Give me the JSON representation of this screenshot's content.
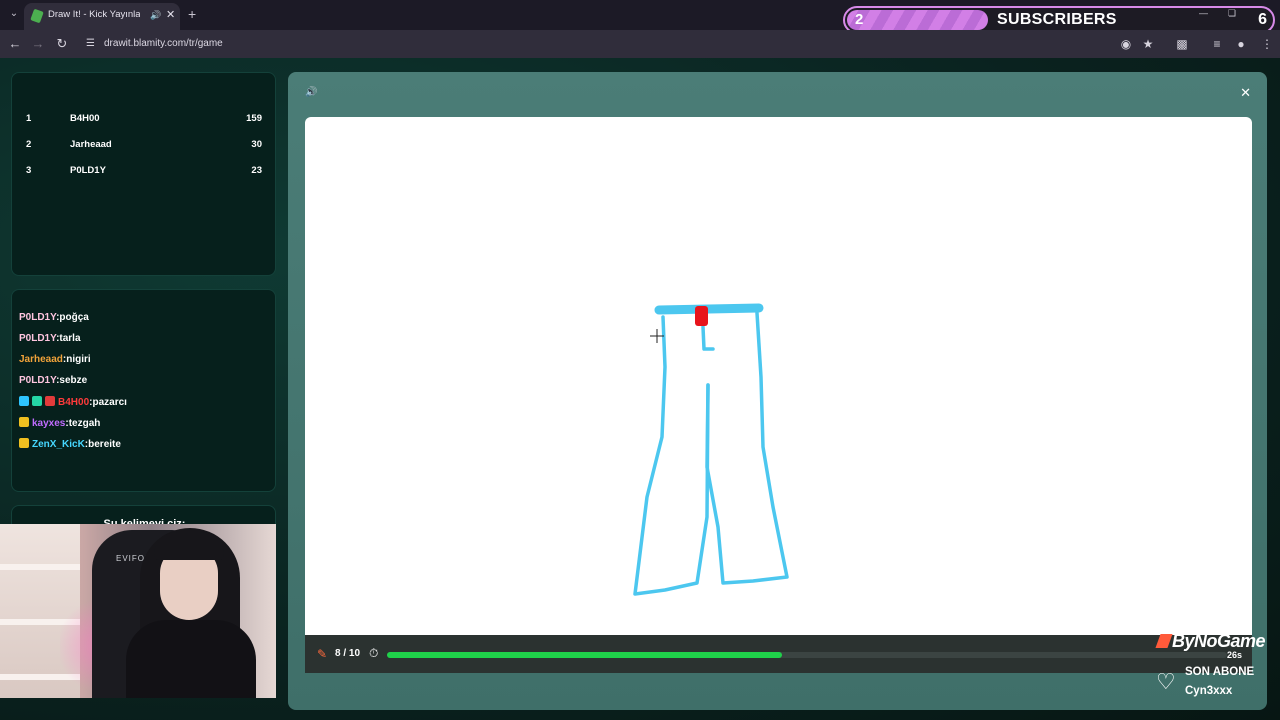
{
  "browser": {
    "tab_title": "Draw It! - Kick Yayınları İçin",
    "url": "drawit.blamity.com/tr/game"
  },
  "overlay": {
    "subscribers_count": "2",
    "subscribers_label": "SUBSCRIBERS",
    "subscribers_goal": "6",
    "subscribers_progress": 0.33,
    "watermark": "ByNoGame",
    "alert_title": "SON ABONE",
    "alert_name": "Cyn3xxx"
  },
  "leaderboard": [
    {
      "rank": "1",
      "name": "B4H00",
      "score": "159"
    },
    {
      "rank": "2",
      "name": "Jarheaad",
      "score": "30"
    },
    {
      "rank": "3",
      "name": "P0LD1Y",
      "score": "23"
    }
  ],
  "chat": [
    {
      "user": "P0LD1Y",
      "message": ":poğça",
      "color": "#ffc6e0",
      "badges": []
    },
    {
      "user": "P0LD1Y",
      "message": ":tarla",
      "color": "#ffc6e0",
      "badges": []
    },
    {
      "user": "Jarheaad",
      "message": ":nigiri",
      "color": "#f2a33a",
      "badges": []
    },
    {
      "user": "P0LD1Y",
      "message": ":sebze",
      "color": "#ffc6e0",
      "badges": []
    },
    {
      "user": "B4H00",
      "message": ":pazarcı",
      "color": "#ff3b3b",
      "badges": [
        "#2ec4ff",
        "#25d6a6",
        "#e23b3b"
      ]
    },
    {
      "user": "kayxes",
      "message": ":tezgah",
      "color": "#c06cff",
      "badges": [
        "#f0c020"
      ]
    },
    {
      "user": "ZenX_KicK",
      "message": ":bereite",
      "color": "#46d7ff",
      "badges": [
        "#f0c020"
      ]
    }
  ],
  "hint": {
    "text": "Şu kelimeyi çiz:"
  },
  "game": {
    "round": "8 / 10",
    "time_left": "26s",
    "progress": 0.47
  },
  "colors": {
    "accent_green": "#1fd24a",
    "pants_blue": "#4cc7ef",
    "belt_red": "#e8141b"
  }
}
